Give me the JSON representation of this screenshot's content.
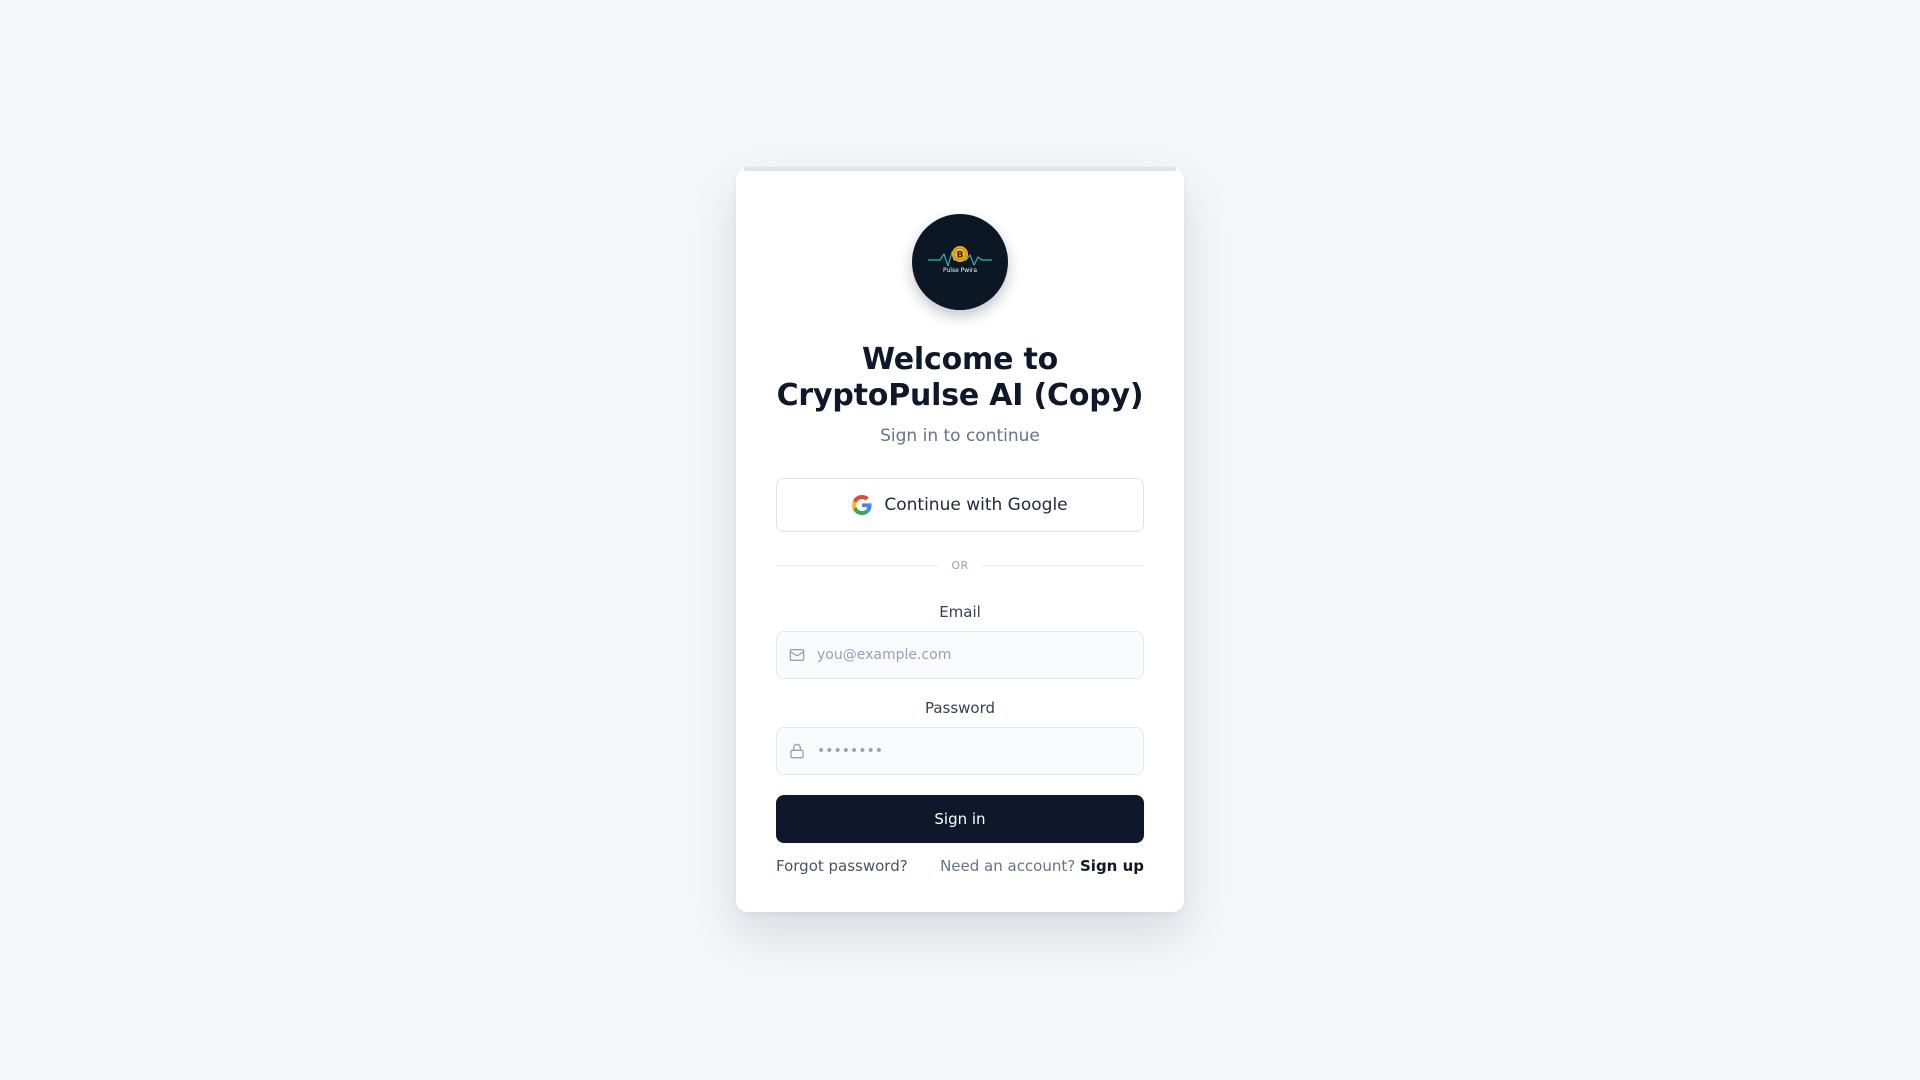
{
  "logo": {
    "text": "Pulse Pwira",
    "coin_glyph": "B",
    "icon": "crypto-pulse-logo",
    "colors": {
      "background": "#0b1724",
      "coin": "#f2b01e",
      "wave": "#2fb6a5"
    }
  },
  "header": {
    "title": "Welcome to CryptoPulse AI (Copy)",
    "subtitle": "Sign in to continue"
  },
  "google": {
    "label": "Continue with Google",
    "icon": "google-icon"
  },
  "divider": {
    "label": "OR"
  },
  "form": {
    "email": {
      "label": "Email",
      "placeholder": "you@example.com",
      "value": "",
      "icon": "mail-icon"
    },
    "password": {
      "label": "Password",
      "placeholder": "••••••••",
      "value": "",
      "icon": "lock-icon"
    },
    "submit_label": "Sign in"
  },
  "footer": {
    "forgot_label": "Forgot password?",
    "need_account_label": "Need an account?",
    "signup_label": "Sign up"
  },
  "colors": {
    "page_background": "#f4f6f9",
    "card_background": "#ffffff",
    "primary_button": "#0f172a",
    "title_text": "#0f172a",
    "muted_text": "#64748b"
  }
}
